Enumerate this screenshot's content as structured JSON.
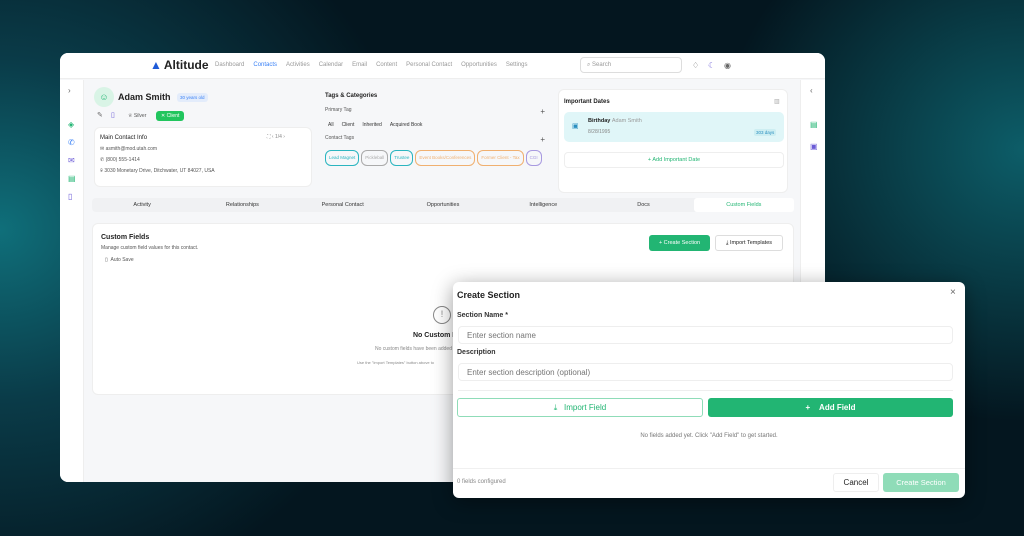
{
  "app": {
    "brand": "Altitude",
    "nav": [
      "Dashboard",
      "Contacts",
      "Activities",
      "Calendar",
      "Email",
      "Content",
      "Personal Contact",
      "Opportunities",
      "Settings"
    ],
    "active_nav": "Contacts",
    "search_placeholder": "Search"
  },
  "contact": {
    "name": "Adam Smith",
    "age": "30 years old",
    "tier": "Silver",
    "status": "Client",
    "main_info_title": "Main Contact Info",
    "pager": "1/4",
    "email": "asmith@mod.utah.com",
    "phone": "(800) 555-1414",
    "address": "3030 Monetary Drive, Ditchwater, UT 84027, USA"
  },
  "tags": {
    "title": "Tags & Categories",
    "primary_label": "Primary Tag",
    "filters": [
      "All",
      "Client",
      "Inherited",
      "Acquired Book"
    ],
    "contact_label": "Contact Tags",
    "items": [
      {
        "label": "Lead Magnet",
        "color": "#2bb5c0"
      },
      {
        "label": "Pickleball",
        "color": "#aaaaaa"
      },
      {
        "label": "Trustee",
        "color": "#2bb5c0"
      },
      {
        "label": "Event Books/Conferences",
        "color": "#f0b070"
      },
      {
        "label": "Former Client - Tax",
        "color": "#f0b070"
      },
      {
        "label": "CGI",
        "color": "#a89ae0"
      }
    ]
  },
  "dates": {
    "title": "Important Dates",
    "event": "Birthday",
    "person": "Adam Smith",
    "date": "8/28/1995",
    "countdown": "303 days",
    "add": "+ Add Important Date"
  },
  "tabs": [
    "Activity",
    "Relationships",
    "Personal Contact",
    "Opportunities",
    "Intelligence",
    "Docs",
    "Custom Fields"
  ],
  "active_tab": "Custom Fields",
  "custom": {
    "title": "Custom Fields",
    "subtitle": "Manage custom field values for this contact.",
    "autosave": "Auto Save",
    "create": "+ Create Section",
    "import": "Import Templates",
    "empty_title": "No Custom Fields",
    "empty_text": "No custom fields have been added",
    "empty_hint": "Use the \"Import Templates\" button above to"
  },
  "modal": {
    "title": "Create Section",
    "name_label": "Section Name *",
    "name_placeholder": "Enter section name",
    "desc_label": "Description",
    "desc_placeholder": "Enter section description (optional)",
    "import_field": "Import Field",
    "add_field": "Add Field",
    "empty": "No fields added yet. Click \"Add Field\" to get started.",
    "count": "0 fields configured",
    "cancel": "Cancel",
    "create": "Create Section"
  },
  "colors": {
    "accent": "#22b573",
    "link": "#3b82f6"
  }
}
